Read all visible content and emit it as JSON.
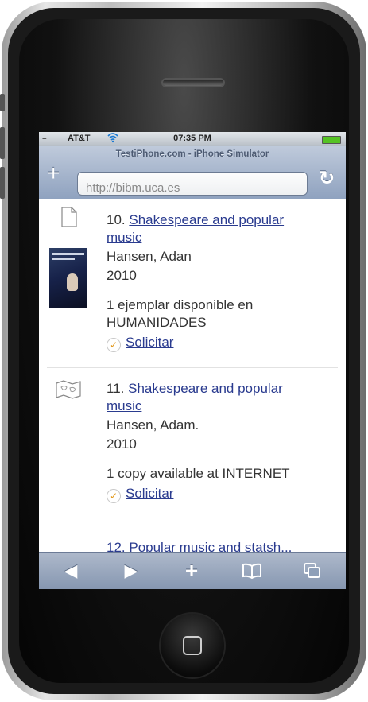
{
  "status_bar": {
    "signal": ".....",
    "carrier": "AT&T",
    "wifi_icon": "wifi-icon",
    "time": "07:35 PM",
    "battery_color": "#55c324"
  },
  "browser": {
    "title": "TestiPhone.com - iPhone Simulator",
    "url": "http://bibm.uca.es",
    "add_icon": "+",
    "reload_icon": "↻"
  },
  "results": [
    {
      "number": "10.",
      "title_line1": "Shakespeare and popular",
      "title_line2": "music",
      "author": "Hansen, Adan",
      "year": "2010",
      "availability_line1": "1 ejemplar disponible en",
      "availability_line2": "HUMANIDADES",
      "action": "Solicitar",
      "type_icon": "document-icon"
    },
    {
      "number": "11.",
      "title_line1": "Shakespeare and popular",
      "title_line2": "music",
      "author": "Hansen, Adam.",
      "year": "2010",
      "availability_line1": "1 copy available at INTERNET",
      "action": "Solicitar",
      "type_icon": "map-icon"
    }
  ],
  "partial_next": "12. Popular music and statsh...",
  "toolbar": {
    "back": "◀",
    "forward": "▶",
    "add": "+",
    "bookmarks": "📖",
    "pages": "⧉"
  }
}
